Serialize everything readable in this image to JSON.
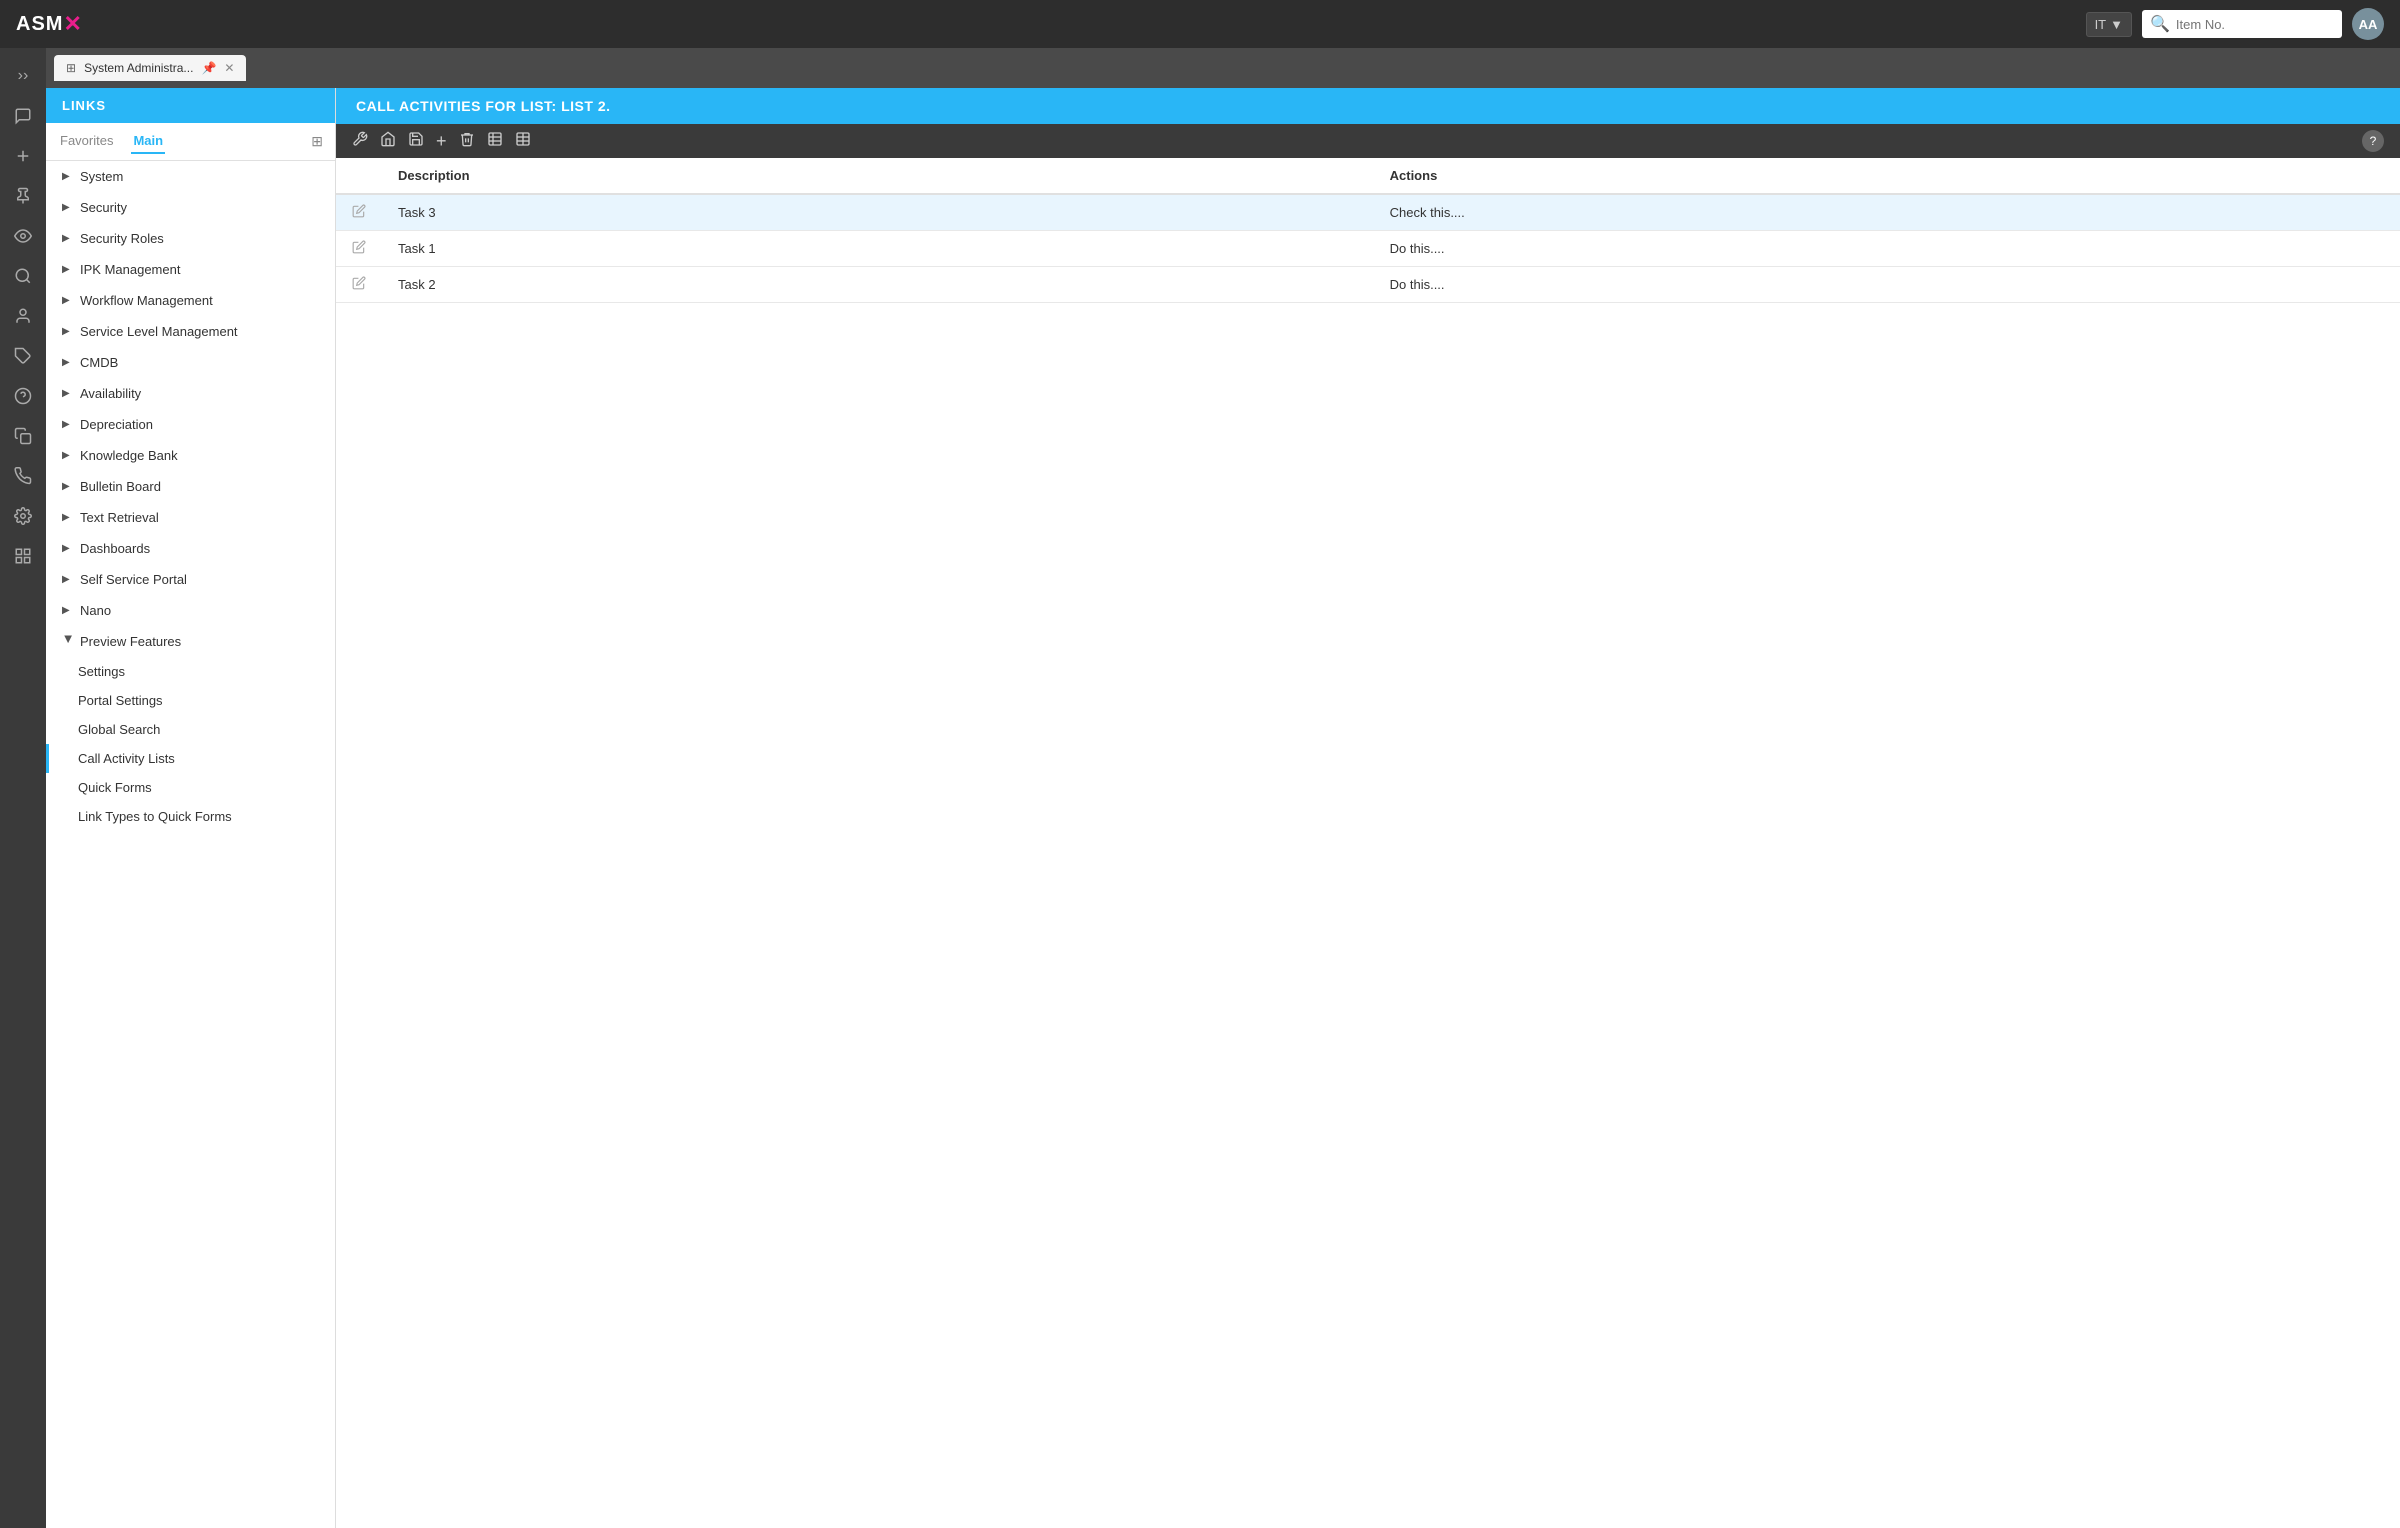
{
  "app": {
    "logo_asm": "ASM",
    "logo_x1": "✕",
    "logo_x2": "✕"
  },
  "topnav": {
    "it_label": "IT",
    "search_placeholder": "Item No.",
    "avatar_label": "AA"
  },
  "tabs": [
    {
      "label": "System Administra...",
      "tab_icon": "⊞",
      "close_icon": "✕",
      "pin_icon": "📌",
      "active": true
    }
  ],
  "sidebar": {
    "header": "LINKS",
    "tabs": [
      {
        "label": "Favorites",
        "active": false
      },
      {
        "label": "Main",
        "active": true
      }
    ],
    "grid_icon": "⊞",
    "nav_items": [
      {
        "label": "System",
        "expanded": false,
        "children": []
      },
      {
        "label": "Security",
        "expanded": false,
        "children": []
      },
      {
        "label": "Security Roles",
        "expanded": false,
        "children": []
      },
      {
        "label": "IPK Management",
        "expanded": false,
        "children": []
      },
      {
        "label": "Workflow Management",
        "expanded": false,
        "children": []
      },
      {
        "label": "Service Level Management",
        "expanded": false,
        "children": []
      },
      {
        "label": "CMDB",
        "expanded": false,
        "children": []
      },
      {
        "label": "Availability",
        "expanded": false,
        "children": []
      },
      {
        "label": "Depreciation",
        "expanded": false,
        "children": []
      },
      {
        "label": "Knowledge Bank",
        "expanded": false,
        "children": []
      },
      {
        "label": "Bulletin Board",
        "expanded": false,
        "children": []
      },
      {
        "label": "Text Retrieval",
        "expanded": false,
        "children": []
      },
      {
        "label": "Dashboards",
        "expanded": false,
        "children": []
      },
      {
        "label": "Self Service Portal",
        "expanded": false,
        "children": []
      },
      {
        "label": "Nano",
        "expanded": false,
        "children": []
      },
      {
        "label": "Preview Features",
        "expanded": true,
        "children": [
          {
            "label": "Settings",
            "active": false
          },
          {
            "label": "Portal Settings",
            "active": false
          },
          {
            "label": "Global Search",
            "active": false
          },
          {
            "label": "Call Activity Lists",
            "active": true
          },
          {
            "label": "Quick Forms",
            "active": false
          },
          {
            "label": "Link Types to Quick Forms",
            "active": false
          }
        ]
      }
    ]
  },
  "main": {
    "panel_title": "CALL ACTIVITIES FOR LIST: LIST 2.",
    "toolbar_icons": [
      {
        "name": "wrench-icon",
        "symbol": "🔧"
      },
      {
        "name": "home-icon",
        "symbol": "🏠"
      },
      {
        "name": "save-icon",
        "symbol": "💾"
      },
      {
        "name": "add-icon",
        "symbol": "+"
      },
      {
        "name": "delete-icon",
        "symbol": "🗑"
      },
      {
        "name": "grid1-icon",
        "symbol": "⊞"
      },
      {
        "name": "grid2-icon",
        "symbol": "⊟"
      }
    ],
    "help_label": "?",
    "table": {
      "columns": [
        {
          "key": "description",
          "label": "Description"
        },
        {
          "key": "actions",
          "label": "Actions"
        }
      ],
      "rows": [
        {
          "id": 1,
          "description": "Task 3",
          "actions": "Check this....",
          "selected": true
        },
        {
          "id": 2,
          "description": "Task 1",
          "actions": "Do this....",
          "selected": false
        },
        {
          "id": 3,
          "description": "Task 2",
          "actions": "Do this....",
          "selected": false
        }
      ]
    }
  },
  "rail_icons": [
    {
      "name": "chevron-right-icon",
      "symbol": "››"
    },
    {
      "name": "chat-icon",
      "symbol": "💬"
    },
    {
      "name": "plus-icon",
      "symbol": "+"
    },
    {
      "name": "pin-icon",
      "symbol": "📌"
    },
    {
      "name": "eye-icon",
      "symbol": "👁"
    },
    {
      "name": "search-icon",
      "symbol": "🔍"
    },
    {
      "name": "person-search-icon",
      "symbol": "👤"
    },
    {
      "name": "tag-icon",
      "symbol": "🏷"
    },
    {
      "name": "help-icon",
      "symbol": "?"
    },
    {
      "name": "copy-icon",
      "symbol": "📋"
    },
    {
      "name": "phone-icon",
      "symbol": "📞"
    },
    {
      "name": "gear-icon",
      "symbol": "⚙"
    },
    {
      "name": "apps-icon",
      "symbol": "⊞"
    }
  ]
}
